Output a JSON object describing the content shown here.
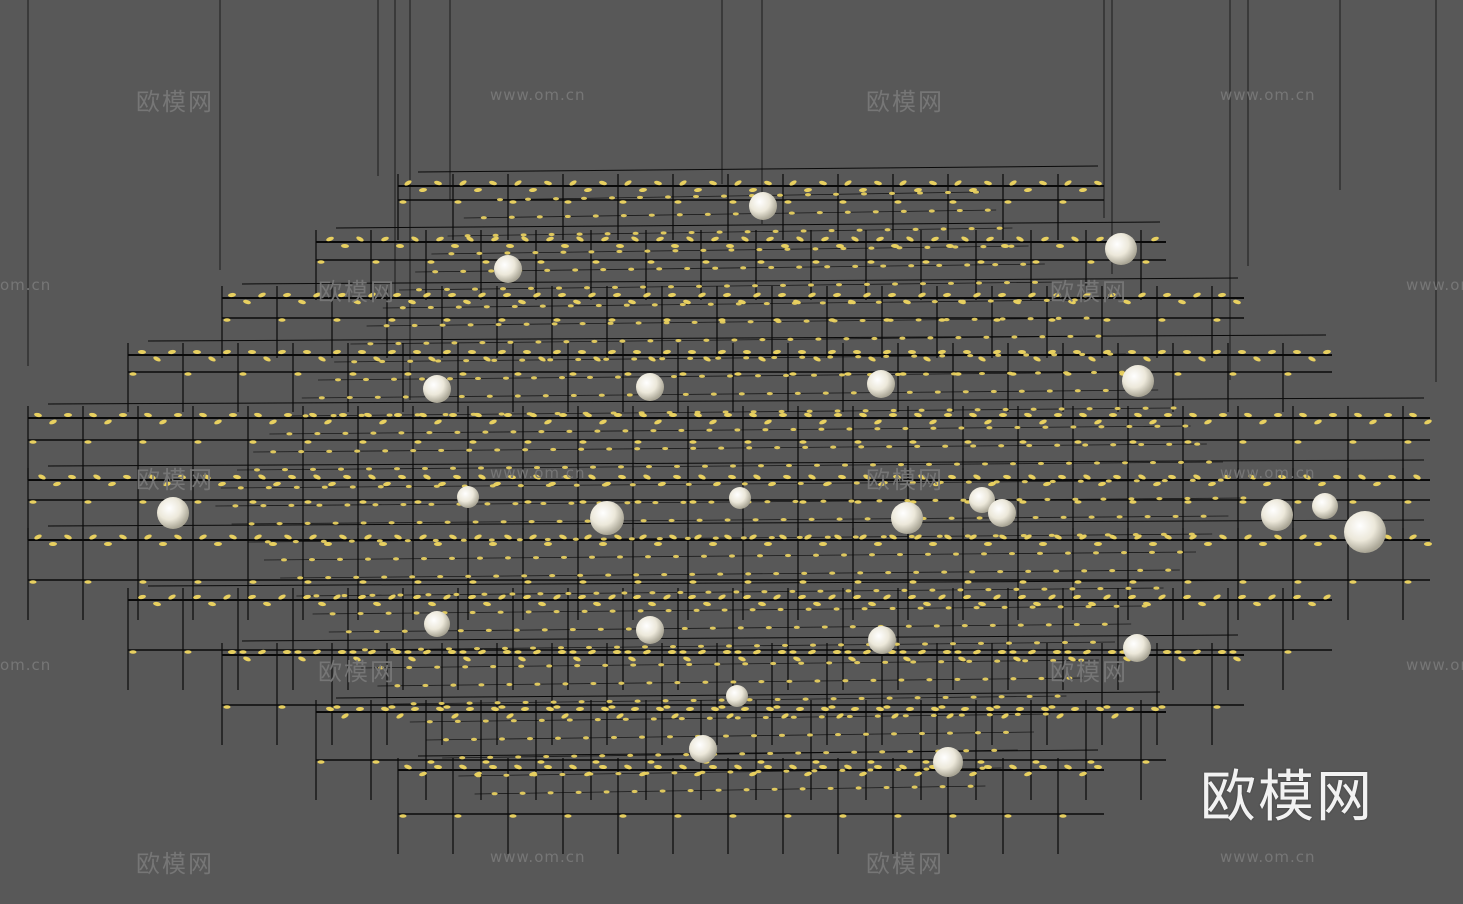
{
  "watermark": {
    "cn": "欧模网",
    "url": "www.om.cn",
    "url_partial": "om.cn",
    "brand": "欧模网"
  },
  "colors": {
    "background": "#585858",
    "frame": "#0a0a0a",
    "led": "#e8d060",
    "sphere": "#e8e4d4",
    "watermark": "#787878",
    "brand": "#f2f2f2"
  },
  "icons": {
    "render": "3d-rendered-wire-cube-chandelier"
  }
}
